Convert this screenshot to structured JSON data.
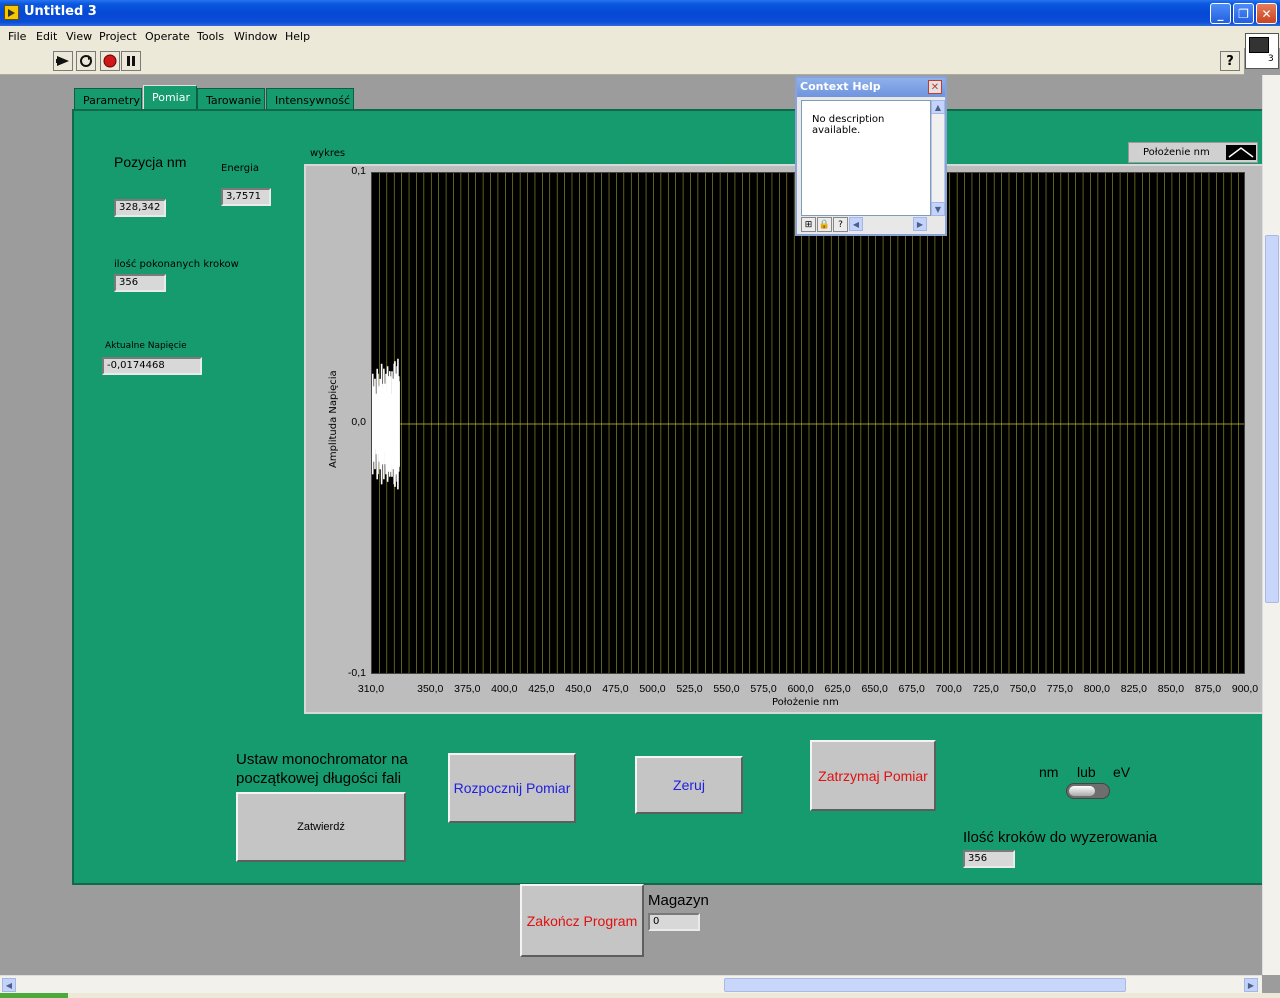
{
  "window": {
    "title": "Untitled 3",
    "minimize": "_",
    "maximize": "❐",
    "close": "✕"
  },
  "menu": [
    "File",
    "Edit",
    "View",
    "Project",
    "Operate",
    "Tools",
    "Window",
    "Help"
  ],
  "vi_icon_label": "3",
  "tabs": [
    "Parametry",
    "Pomiar",
    "Tarowanie",
    "Intensywność"
  ],
  "active_tab": "Pomiar",
  "readouts": {
    "pozycja_label": "Pozycja nm",
    "pozycja_value": "328,342",
    "energia_label": "Energia",
    "energia_value": "3,7571",
    "kroki_label": "ilość pokonanych krokow",
    "kroki_value": "356",
    "napiecie_label": "Aktualne Napięcie",
    "napiecie_value": "-0,0174468"
  },
  "chart_data": {
    "type": "line",
    "title": "wykres",
    "xlabel": "Położenie nm",
    "ylabel": "Amplituda Napięcia",
    "xlim": [
      310,
      900
    ],
    "ylim": [
      -0.1,
      0.1
    ],
    "x_ticks": [
      "310,0",
      "350,0",
      "375,0",
      "400,0",
      "425,0",
      "450,0",
      "475,0",
      "500,0",
      "525,0",
      "550,0",
      "575,0",
      "600,0",
      "625,0",
      "650,0",
      "675,0",
      "700,0",
      "725,0",
      "750,0",
      "775,0",
      "800,0",
      "825,0",
      "850,0",
      "875,0",
      "900,0"
    ],
    "x_tick_values": [
      310,
      350,
      375,
      400,
      425,
      450,
      475,
      500,
      525,
      550,
      575,
      600,
      625,
      650,
      675,
      700,
      725,
      750,
      775,
      800,
      825,
      850,
      875,
      900
    ],
    "y_ticks": [
      "0,1",
      "0,0",
      "-0,1"
    ],
    "y_tick_values": [
      0.1,
      0.0,
      -0.1
    ],
    "grid": true,
    "legend": {
      "position": "top-right",
      "entries": [
        "Położenie nm"
      ]
    },
    "series": [
      {
        "name": "Położenie nm",
        "color": "#ffffff",
        "x": [
          310.0,
          310.5,
          311.0,
          311.5,
          312.0,
          312.5,
          313.0,
          313.5,
          314.0,
          314.5,
          315.0,
          315.5,
          316.0,
          316.5,
          317.0,
          317.5,
          318.0,
          318.5,
          319.0,
          319.5,
          320.0,
          320.5,
          321.0,
          321.5,
          322.0,
          322.5,
          323.0,
          323.5,
          324.0,
          324.5,
          325.0,
          325.5,
          326.0,
          326.5,
          327.0,
          327.5,
          328.0,
          328.3
        ],
        "y": [
          0.01,
          -0.02,
          0.008,
          -0.015,
          0.018,
          -0.01,
          0.012,
          -0.022,
          0.02,
          -0.012,
          0.015,
          -0.018,
          0.017,
          -0.024,
          0.014,
          -0.016,
          0.022,
          -0.011,
          0.016,
          -0.02,
          0.013,
          -0.023,
          0.019,
          -0.014,
          0.021,
          -0.019,
          0.012,
          -0.021,
          0.018,
          -0.017,
          0.024,
          -0.025,
          0.02,
          -0.02,
          0.023,
          -0.026,
          0.019,
          -0.017
        ]
      }
    ]
  },
  "controls": {
    "ustaw_label": "Ustaw monochromator na początkowej długości fali",
    "zatwierdz": "Zatwierdź",
    "rozpocznij": "Rozpocznij Pomiar",
    "zeruj": "Zeruj",
    "zatrzymaj": "Zatrzymaj Pomiar",
    "switch_nm": "nm",
    "switch_lub": "lub",
    "switch_ev": "eV",
    "kroki_zero_label": "Ilość kroków do wyzerowania",
    "kroki_zero_value": "356",
    "zakoncz": "Zakończ Program",
    "magazyn_label": "Magazyn",
    "magazyn_value": "0"
  },
  "context_help": {
    "title": "Context Help",
    "text": "No description available."
  },
  "colors": {
    "panel_green": "#169b6e",
    "plot_bg": "#000000",
    "grid": "#c8c832",
    "blue_text": "#2020e0",
    "red_text": "#e01010"
  }
}
